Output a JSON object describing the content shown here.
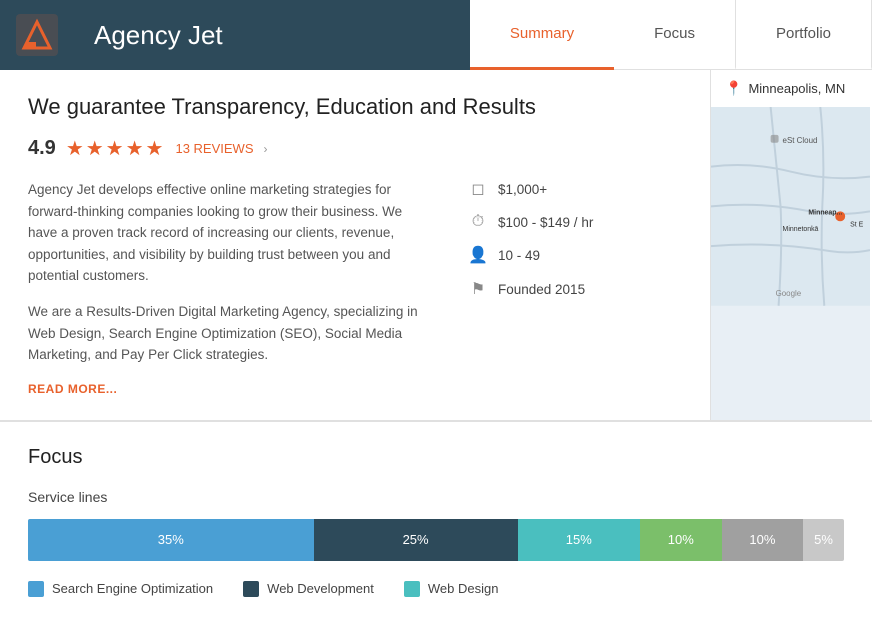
{
  "header": {
    "agency_name": "Agency Jet",
    "logo_alt": "Agency Jet Logo"
  },
  "nav": {
    "tabs": [
      {
        "label": "Summary",
        "active": true
      },
      {
        "label": "Focus",
        "active": false
      },
      {
        "label": "Portfolio",
        "active": false
      }
    ]
  },
  "summary": {
    "title": "We guarantee Transparency, Education and Results",
    "rating": "4.9",
    "stars": "★★★★★",
    "reviews_label": "13 REVIEWS",
    "description_1": "Agency Jet develops effective online marketing strategies for forward-thinking companies looking to grow their business. We have a proven track record of increasing our clients, revenue, opportunities, and visibility by building trust between you and potential customers.",
    "description_2": "We are a Results-Driven Digital Marketing Agency, specializing in Web Design, Search Engine Optimization (SEO), Social Media Marketing, and Pay Per Click strategies.",
    "read_more": "READ MORE...",
    "meta": {
      "budget": "$1,000+",
      "rate": "$100 - $149 / hr",
      "employees": "10 - 49",
      "founded": "Founded 2015"
    },
    "location": "Minneapolis, MN"
  },
  "focus": {
    "section_title": "Focus",
    "service_lines_label": "Service lines",
    "bars": [
      {
        "label": "35%",
        "percent": 35,
        "color": "#4a9fd4"
      },
      {
        "label": "25%",
        "percent": 25,
        "color": "#2d4a5a"
      },
      {
        "label": "15%",
        "percent": 15,
        "color": "#4abfbf"
      },
      {
        "label": "10%",
        "percent": 10,
        "color": "#7bbf6a"
      },
      {
        "label": "10%",
        "percent": 10,
        "color": "#a0a0a0"
      },
      {
        "label": "5%",
        "percent": 5,
        "color": "#c8c8c8"
      }
    ],
    "legend": [
      {
        "label": "Search Engine Optimization",
        "color": "#4a9fd4"
      },
      {
        "label": "Web Development",
        "color": "#2d4a5a"
      },
      {
        "label": "Web Design",
        "color": "#4abfbf"
      }
    ]
  }
}
